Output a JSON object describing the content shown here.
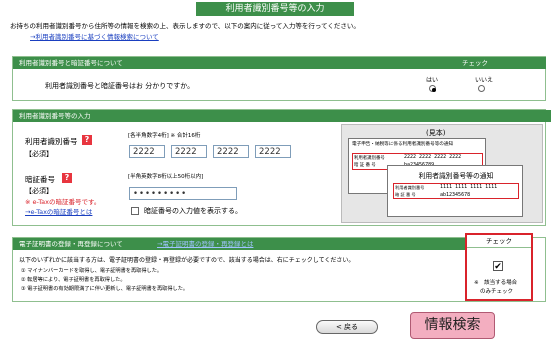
{
  "title": "利用者識別番号等の入力",
  "intro": {
    "text": "お持ちの利用者識別番号から住所等の情報を検索の上、表示しますので、以下の案内に従って入力等を行ってください。",
    "link": "→利用者識別番号に基づく情報検索について"
  },
  "sec1": {
    "header": "利用者識別番号と暗証番号について",
    "check_header": "チェック",
    "question": "利用者識別番号と暗証番号はお 分かりですか。",
    "yes": "はい",
    "no": "いいえ",
    "selected": "yes"
  },
  "sec2": {
    "header": "利用者識別番号等の入力",
    "id_label": "利用者識別番号",
    "id_required": "【必須】",
    "id_hint": "[各半角数字4桁]  ※ 合計16桁",
    "id_values": [
      "2222",
      "2222",
      "2222",
      "2222"
    ],
    "pw_label": "暗証番号",
    "pw_required": "【必須】",
    "pw_note": "※ e-Taxの暗証番号です。",
    "pw_link": "→e-Taxの暗証番号とは",
    "pw_hint": "[半角英数字8桁以上50桁以内]",
    "pw_value": "•••••••••",
    "pw_show_label": "暗証番号の入力値を表示する。",
    "sample": {
      "label": "(見本)",
      "doc_title": "電子申告・納税等に係る利用者識別番号等の通知",
      "row_id_label": "利用者識別番号",
      "row_pw_label": "暗 証 番 号",
      "doc_id": "2222 2222 2222 2222",
      "doc_pw": "ba23456789",
      "card_title": "利用者識別番号等の通知",
      "card_id": "1111 1111 1111 1111",
      "card_pw": "ab12345678"
    }
  },
  "sec3": {
    "header": "電子証明書の登録・再登録について",
    "header_link": "→電子証明書の登録・再登録とは",
    "check_header": "チェック",
    "text": "以下のいずれかに該当する方は、電子証明書の登録・再登録が必要ですので、該当する場合は、右にチェックしてください。",
    "items": [
      "① マイナンバーカードを取得し、電子証明書を再取得した。",
      "② 転居等により、電子証明書を再取得した。",
      "③ 電子証明書の有効期限満了に伴い更新し、電子証明書を再取得した。"
    ],
    "check_note_1": "※　該当する場合",
    "check_note_2": "のみチェック",
    "checked": true
  },
  "buttons": {
    "back": "< 戻る",
    "search": "情報検索"
  },
  "colors": {
    "section_green": "#3d8f4a",
    "link_blue": "#1a3fc0",
    "required_red": "#d9232b",
    "search_pink": "#f3aec0"
  }
}
